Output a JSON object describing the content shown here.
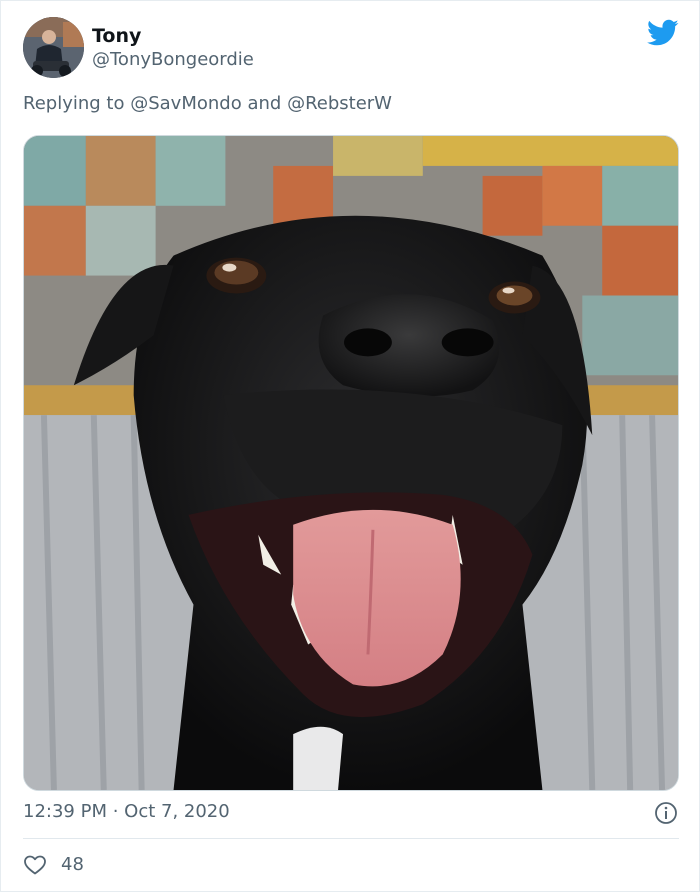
{
  "tweet": {
    "display_name": "Tony",
    "handle": "@TonyBongeordie",
    "reply_prefix": "Replying to",
    "reply_mention_1": "@SavMondo",
    "reply_and": "and",
    "reply_mention_2": "@RebsterW",
    "timestamp": "12:39 PM · Oct 7, 2020",
    "like_count": "48"
  },
  "icons": {
    "brand": "twitter-bird-icon",
    "info": "info-icon",
    "like": "heart-icon"
  },
  "colors": {
    "brand_blue": "#1d9bf0",
    "secondary_text": "#536471",
    "primary_text": "#0f1419",
    "divider": "#e1e8ed"
  }
}
